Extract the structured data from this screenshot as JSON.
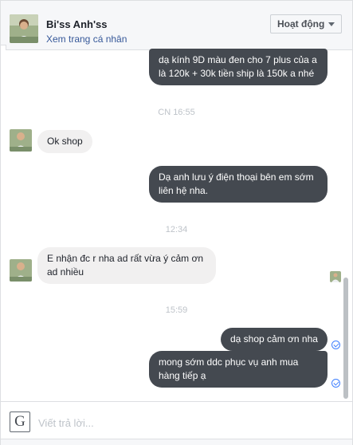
{
  "header": {
    "name": "Bi'ss Anh'ss",
    "profile_link": "Xem trang cá nhân",
    "status_button": "Hoạt động"
  },
  "messages": {
    "out_1": "dạ kính 9D màu đen cho 7 plus của a là 120k + 30k tiền ship là 150k a nhé",
    "ts_1": "CN 16:55",
    "in_1": "Ok shop",
    "out_2": "Dạ anh lưu ý điện thoại bên em sớm liên hệ nha.",
    "ts_2": "12:34",
    "in_2": "E nhận đc r nha ad rất vừa ý cảm ơn ad nhiều",
    "ts_3": "15:59",
    "out_3": "dạ shop cảm ơn nha",
    "out_4": "mong sớm ddc phục vụ anh mua hàng tiếp ạ"
  },
  "composer": {
    "logo_letter": "G",
    "placeholder": "Viết trả lời..."
  },
  "colors": {
    "outgoing_bubble": "#444950",
    "incoming_bubble": "#f1f0f0",
    "link": "#365899",
    "seen_check": "#4080ff"
  }
}
